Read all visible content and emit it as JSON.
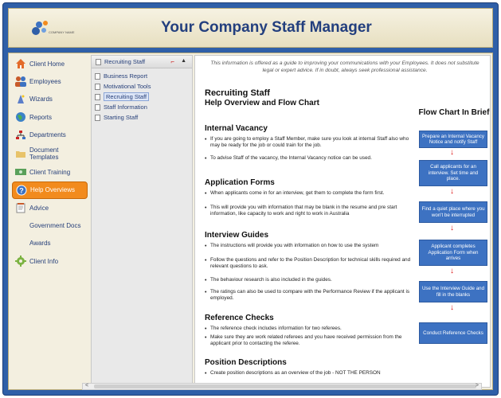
{
  "header": {
    "logo_text": "COMPANY NAME",
    "title": "Your Company Staff Manager"
  },
  "nav": {
    "items": [
      {
        "label": "Client Home",
        "icon": "house-icon"
      },
      {
        "label": "Employees",
        "icon": "people-icon"
      },
      {
        "label": "Wizards",
        "icon": "wizard-icon"
      },
      {
        "label": "Reports",
        "icon": "globe-icon"
      },
      {
        "label": "Departments",
        "icon": "org-chart-icon"
      },
      {
        "label": "Document Templates",
        "icon": "folder-icon"
      },
      {
        "label": "Client Training",
        "icon": "money-icon"
      },
      {
        "label": "Help Overviews",
        "icon": "help-icon",
        "active": true
      },
      {
        "label": "Advice",
        "icon": "notepad-icon"
      },
      {
        "label": "Government Docs",
        "icon": "blank-icon"
      },
      {
        "label": "Awards",
        "icon": "blank-icon"
      },
      {
        "label": "Client Info",
        "icon": "gear-icon"
      }
    ]
  },
  "subpanel": {
    "header": "Recruiting Staff",
    "items": [
      {
        "label": "Business Report"
      },
      {
        "label": "Motivational Tools"
      },
      {
        "label": "Recruiting Staff",
        "selected": true
      },
      {
        "label": "Staff Information"
      },
      {
        "label": "Starting Staff"
      }
    ]
  },
  "content": {
    "disclaimer": "This information is offered as a guide to improving your communications with your Employees. It does not substitute legal or expert advice. If in doubt, always seek professional assistance.",
    "title": "Recruiting Staff",
    "subtitle": "Help Overview and Flow Chart",
    "sections": [
      {
        "heading": "Internal Vacancy",
        "bullets": [
          "If you are going to employ a Staff Member, make sure you look at internal Staff also who may be ready for the job or could train for the job.",
          "To advise Staff of the vacancy, the Internal Vacancy notice can be used."
        ]
      },
      {
        "heading": "Application Forms",
        "bullets": [
          "When applicants come in for an interview, get them to complete the form first.",
          "This will provide you with information that may be blank in the resume and pre start information, like capacity to work and right to work in Australia"
        ]
      },
      {
        "heading": "Interview Guides",
        "bullets": [
          "The instructions will provide you with information on how to use the system",
          "Follow the questions and refer to the Position Description for technical skills required and relevant questions to ask.",
          "The behaviour research is also included in the guides.",
          "The ratings can also be used to compare with the Performance Review if the applicant is employed."
        ]
      },
      {
        "heading": "Reference Checks",
        "bullets": [
          "The reference check includes information for two referees.",
          "Make sure they are work related referees and you have received permission from the applicant prior to contacting the referee."
        ]
      },
      {
        "heading": "Position Descriptions",
        "bullets": [
          "Create position descriptions as an overview of the job - NOT THE PERSON"
        ]
      }
    ],
    "flow": {
      "title": "Flow Chart In Brief",
      "steps": [
        "Prepare an Internal Vacancy Notice and notify Staff",
        "Call applicants for an interview. Set time and place.",
        "Find a quiet place where you won't be interrupted",
        "Applicant completes Application Form when arrives",
        "Use the Interview Guide and fill in the blanks",
        "Conduct Reference Checks"
      ],
      "arrow_glyph": "↓"
    }
  },
  "scrollbar": {
    "left": "<",
    "right": ">"
  }
}
